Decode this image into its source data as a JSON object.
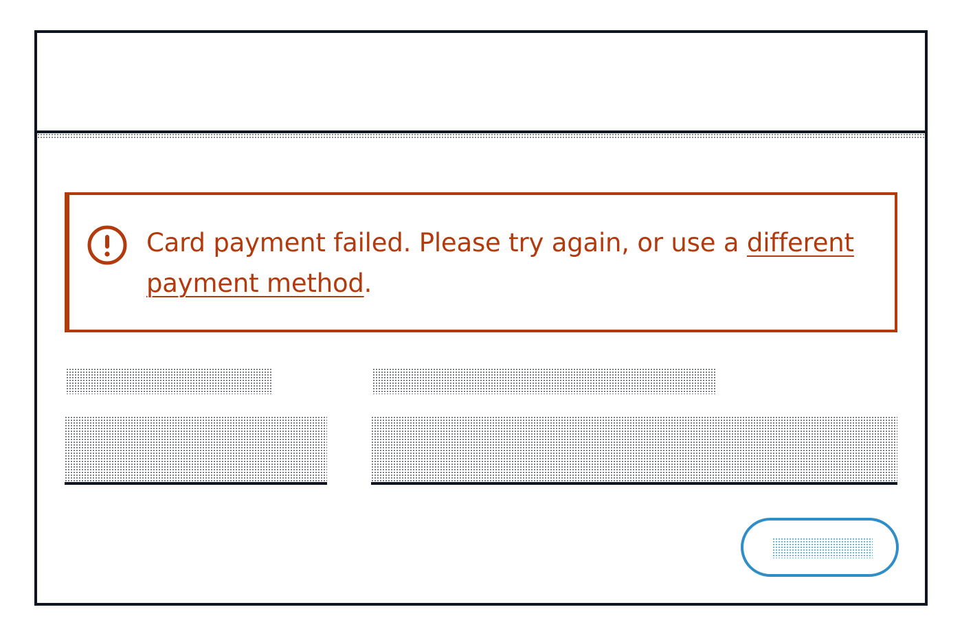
{
  "alert": {
    "icon": "alert-circle-icon",
    "message": "Card payment failed. Please try again, or use a ",
    "link_text": "different payment method",
    "suffix": "."
  },
  "colors": {
    "error": "#b33a0c",
    "border": "#0d1523",
    "button_outline": "#2f8ec7"
  }
}
